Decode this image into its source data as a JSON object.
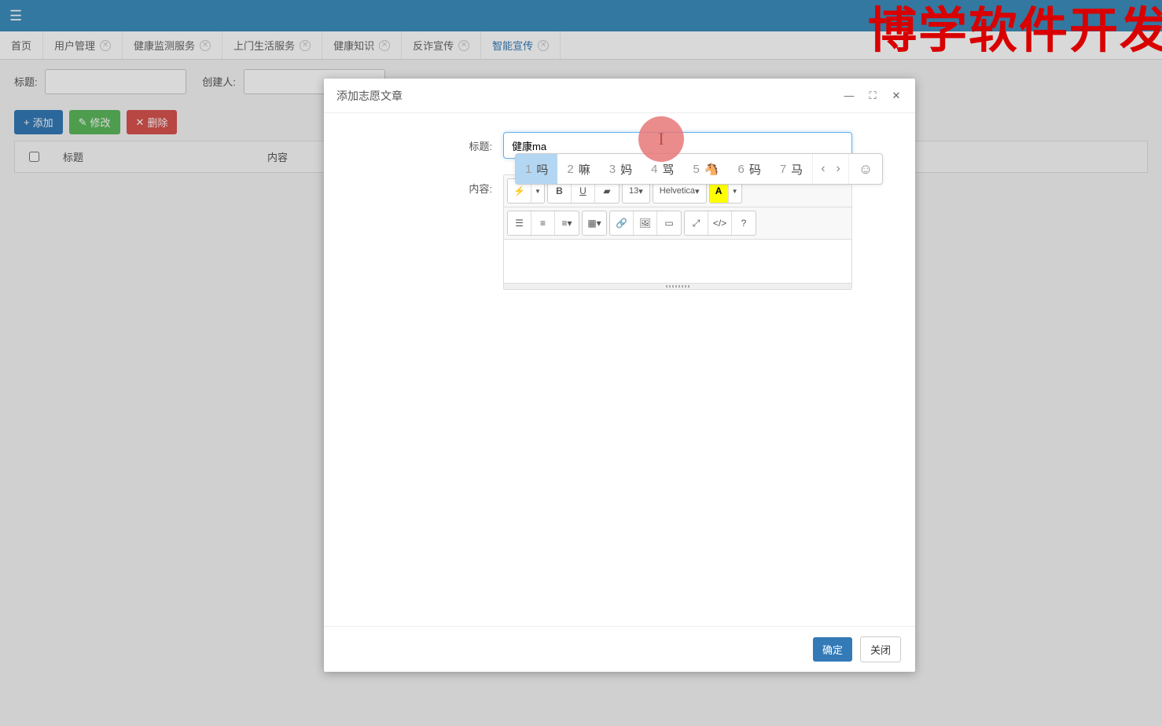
{
  "watermark": "博学软件开发",
  "tabs": [
    {
      "label": "首页",
      "closable": false,
      "active": false
    },
    {
      "label": "用户管理",
      "closable": true,
      "active": false
    },
    {
      "label": "健康监测服务",
      "closable": true,
      "active": false
    },
    {
      "label": "上门生活服务",
      "closable": true,
      "active": false
    },
    {
      "label": "健康知识",
      "closable": true,
      "active": false
    },
    {
      "label": "反诈宣传",
      "closable": true,
      "active": false
    },
    {
      "label": "智能宣传",
      "closable": true,
      "active": true
    }
  ],
  "filter": {
    "title_label": "标题:",
    "creator_label": "创建人:"
  },
  "actions": {
    "add": "添加",
    "edit": "修改",
    "delete": "删除"
  },
  "table": {
    "col_title": "标题",
    "col_content": "内容"
  },
  "modal": {
    "title": "添加志愿文章",
    "field_title_label": "标题:",
    "field_title_value": "健康ma",
    "field_content_label": "内容:",
    "btn_ok": "确定",
    "btn_cancel": "关闭",
    "font_size": "13",
    "font_family": "Helvetica"
  },
  "ime": {
    "candidates": [
      {
        "num": "1",
        "char": "吗"
      },
      {
        "num": "2",
        "char": "嘛"
      },
      {
        "num": "3",
        "char": "妈"
      },
      {
        "num": "4",
        "char": "骂"
      },
      {
        "num": "5",
        "char": "🐴"
      },
      {
        "num": "6",
        "char": "码"
      },
      {
        "num": "7",
        "char": "马"
      }
    ]
  }
}
